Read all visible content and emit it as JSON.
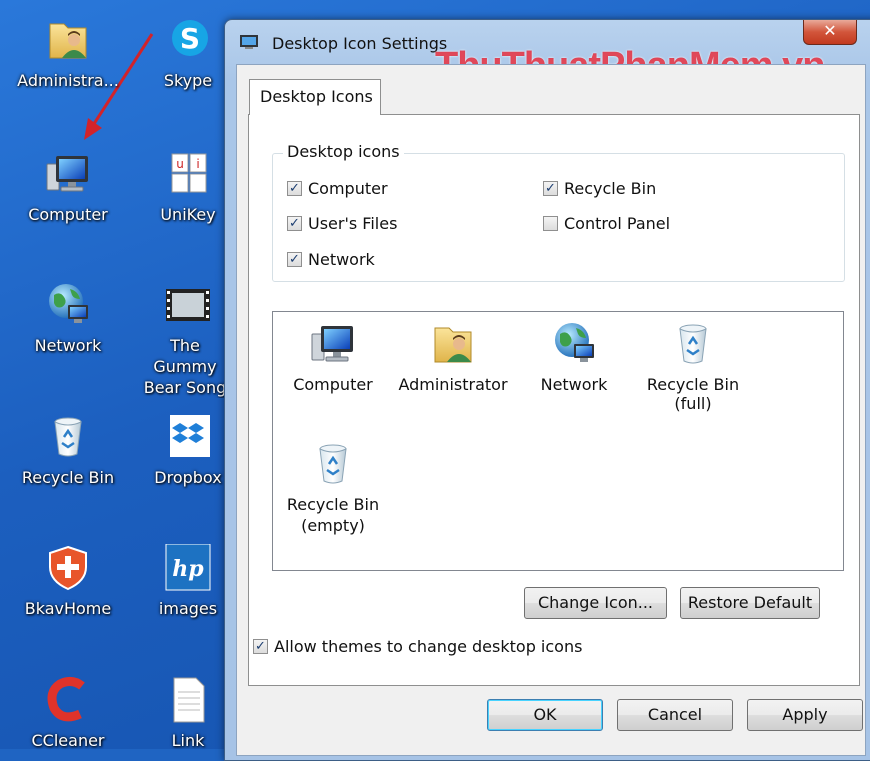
{
  "desktop": {
    "icons": [
      {
        "label": "Administra...",
        "icon": "folder-user-icon"
      },
      {
        "label": "Skype",
        "icon": "skype-icon"
      },
      {
        "label": "Computer",
        "icon": "computer-icon"
      },
      {
        "label": "UniKey",
        "icon": "unikey-icon"
      },
      {
        "label": "Network",
        "icon": "network-icon"
      },
      {
        "label": "The Gummy Bear Song",
        "icon": "video-icon"
      },
      {
        "label": "Recycle Bin",
        "icon": "recycle-bin-icon"
      },
      {
        "label": "Dropbox",
        "icon": "dropbox-icon"
      },
      {
        "label": "BkavHome",
        "icon": "bkav-icon"
      },
      {
        "label": "images",
        "icon": "hp-icon"
      },
      {
        "label": "CCleaner",
        "icon": "ccleaner-icon"
      },
      {
        "label": "Link",
        "icon": "document-icon"
      }
    ]
  },
  "dialog": {
    "title": "Desktop Icon Settings",
    "watermark": "ThuThuatPhanMem.vn",
    "close_glyph": "✕",
    "tab_label": "Desktop Icons",
    "group_label": "Desktop icons",
    "checkboxes": [
      {
        "label": "Computer",
        "checked": true
      },
      {
        "label": "User's Files",
        "checked": true
      },
      {
        "label": "Network",
        "checked": true
      },
      {
        "label": "Recycle Bin",
        "checked": true
      },
      {
        "label": "Control Panel",
        "checked": false
      }
    ],
    "icon_list": [
      {
        "line1": "Computer",
        "line2": "",
        "icon": "computer-icon"
      },
      {
        "line1": "Administrator",
        "line2": "",
        "icon": "folder-user-icon"
      },
      {
        "line1": "Network",
        "line2": "",
        "icon": "network-icon"
      },
      {
        "line1": "Recycle Bin",
        "line2": "(full)",
        "icon": "recycle-bin-full-icon"
      },
      {
        "line1": "Recycle Bin",
        "line2": "(empty)",
        "icon": "recycle-bin-empty-icon"
      }
    ],
    "change_icon_label": "Change Icon...",
    "restore_default_label": "Restore Default",
    "allow_themes": {
      "label": "Allow themes to change desktop icons",
      "checked": true
    },
    "ok_label": "OK",
    "cancel_label": "Cancel",
    "apply_label": "Apply"
  },
  "colors": {
    "desktop": "#1f64c2",
    "watermark": "#dc283c",
    "accent": "#3c7fb1"
  }
}
